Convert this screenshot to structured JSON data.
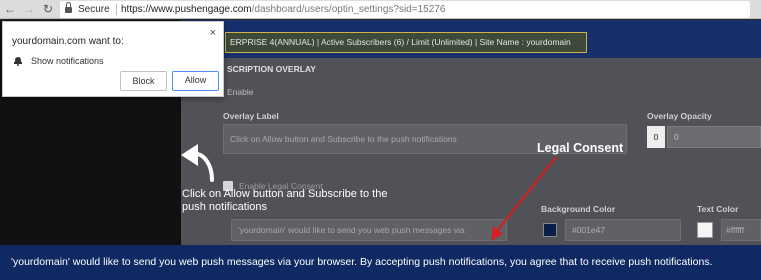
{
  "browser": {
    "secure_label": "Secure",
    "url_host": "https://www.pushengage.com",
    "url_path": "/dashboard/users/optin_settings?sid=15276"
  },
  "permission_popup": {
    "title": "yourdomain.com want to:",
    "permission": "Show notifications",
    "block_label": "Block",
    "allow_label": "Allow",
    "close_glyph": "×"
  },
  "background_page": {
    "info_bar": "ERPRISE 4(ANNUAL) | Active Subscribers (6) / Limit (Unlimited) | Site Name : yourdomain",
    "section_title": "SCRIPTION OVERLAY",
    "enable_label": "Enable",
    "overlay_label_title": "Overlay Label",
    "overlay_label_value": "Click on Allow button and Subscribe to the push notifications",
    "overlay_opacity_title": "Overlay Opacity",
    "opacity_value": "0",
    "opacity_slider_value": "0",
    "checkbox_label": "Enable Legal Consent",
    "consent_message_value": "'yourdomain' would like to send you web push messages via",
    "bg_color_title": "Background Color",
    "bg_color_value": "#001e47",
    "text_color_title": "Text Color",
    "text_color_value": "#ffffff"
  },
  "overlay": {
    "instruction": "Click on Allow button and Subscribe to the push notifications",
    "legal_label": "Legal Consent"
  },
  "consent_bar": {
    "text": "'yourdomain' would like to send you web push messages via your browser. By accepting push notifications, you agree that to receive push notifications."
  },
  "colors": {
    "consent_bar_bg": "#0f2a63",
    "annotation_arrow": "#d42020",
    "allow_border": "#4d90fe"
  }
}
